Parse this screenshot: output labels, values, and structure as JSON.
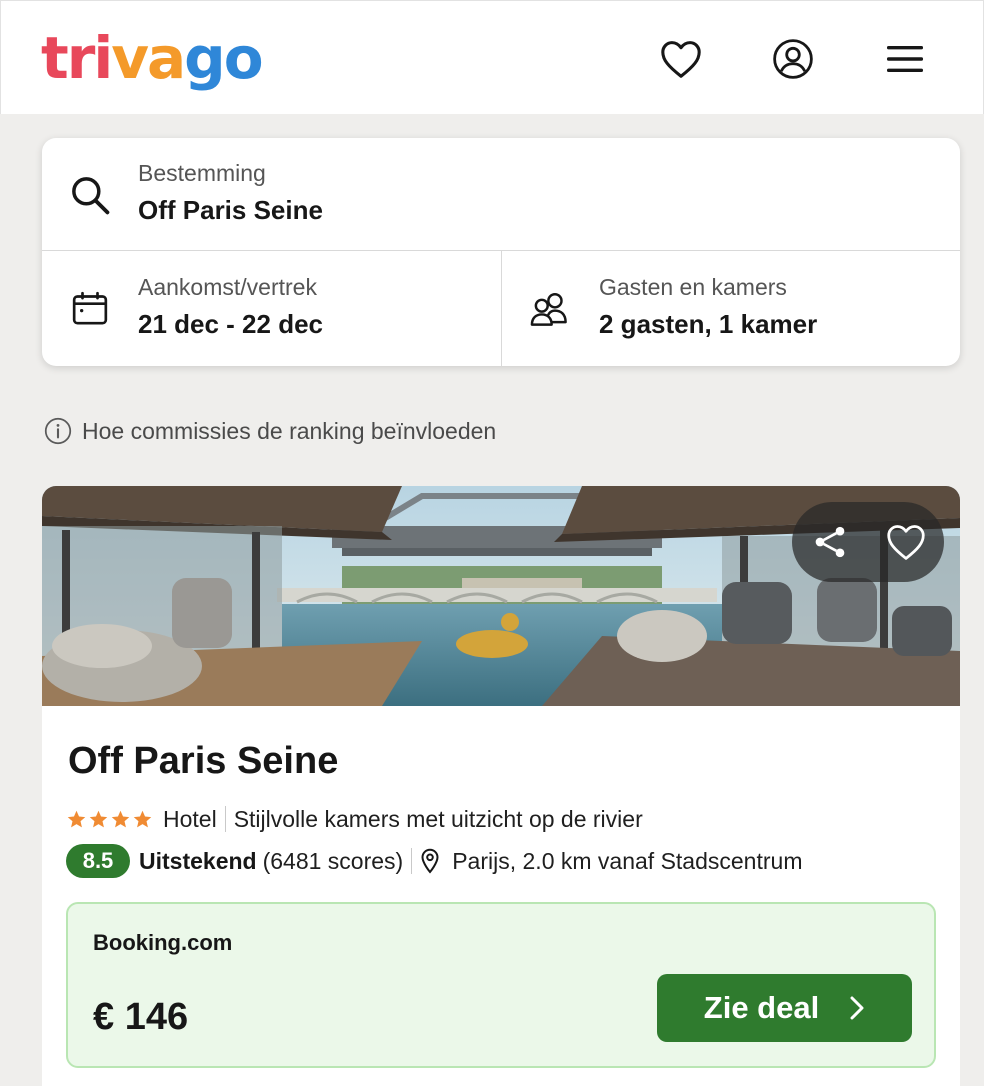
{
  "header": {
    "logo": {
      "part1": "tri",
      "part2": "va",
      "part3": "go"
    },
    "icons": [
      "heart-icon",
      "user-icon",
      "menu-icon"
    ]
  },
  "search": {
    "destination_label": "Bestemming",
    "destination_value": "Off Paris Seine",
    "dates_label": "Aankomst/vertrek",
    "dates_value": "21 dec - 22 dec",
    "guests_label": "Gasten en kamers",
    "guests_value": "2 gasten, 1 kamer"
  },
  "commission_notice": "Hoe commissies de ranking beïnvloeden",
  "hotel": {
    "name": "Off Paris Seine",
    "stars": 4,
    "type": "Hotel",
    "tagline": "Stijlvolle kamers met uitzicht op de rivier",
    "rating": "8.5",
    "rating_label": "Uitstekend",
    "rating_count": "(6481 scores)",
    "location": "Parijs, 2.0 km vanaf Stadscentrum"
  },
  "deal": {
    "partner": "Booking.com",
    "price": "€ 146",
    "button_label": "Zie deal"
  },
  "colors": {
    "accent_green": "#2f7b2e",
    "deal_bg": "#ebf8e9",
    "star": "#f08b33",
    "logo_red": "#e8485b",
    "logo_orange": "#f49a2a",
    "logo_blue": "#2f87d8"
  }
}
